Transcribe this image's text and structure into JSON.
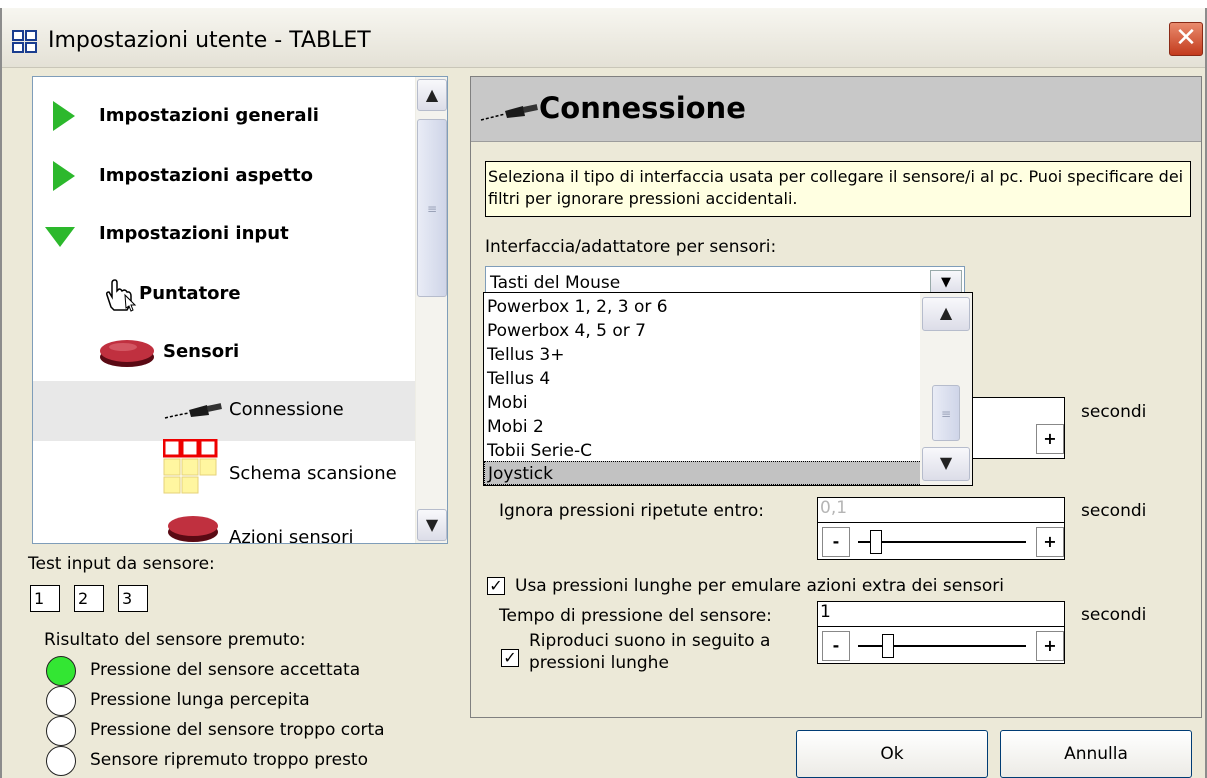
{
  "window": {
    "title": "Impostazioni utente - TABLET",
    "close_label": "✕"
  },
  "tree": {
    "items": [
      {
        "label": "Impostazioni generali"
      },
      {
        "label": "Impostazioni aspetto"
      },
      {
        "label": "Impostazioni input"
      },
      {
        "label": "Puntatore"
      },
      {
        "label": "Sensori"
      },
      {
        "label": "Connessione"
      },
      {
        "label": "Schema scansione"
      },
      {
        "label": "Azioni sensori"
      }
    ]
  },
  "test": {
    "label": "Test input da sensore:",
    "boxes": [
      "1",
      "2",
      "3"
    ],
    "result_label": "Risultato del sensore premuto:",
    "results": [
      "Pressione del sensore accettata",
      "Pressione lunga percepita",
      "Pressione del sensore troppo corta",
      "Sensore ripremuto troppo presto"
    ]
  },
  "panel": {
    "title": "Connessione",
    "info": "Seleziona il tipo di interfaccia usata per collegare il sensore/i al pc. Puoi specificare dei filtri per ignorare pressioni accidentali.",
    "interface_label": "Interfaccia/adattatore per sensori:",
    "interface_value": "Tasti del Mouse",
    "dropdown_options": [
      "Powerbox 1, 2, 3 or 6",
      "Powerbox 4, 5 or 7",
      "Tellus 3+",
      "Tellus 4",
      "Mobi",
      "Mobi 2",
      "Tobii Serie-C",
      "Joystick"
    ],
    "seconds": "secondi",
    "ignore_label": "Ignora pressioni ripetute entro:",
    "ignore_value": "0,1",
    "long_press_label": "Usa pressioni lunghe per emulare azioni extra dei sensori",
    "press_time_label": "Tempo di pressione del sensore:",
    "press_time_value": "1",
    "sound_label_1": "Riproduci suono in seguito a",
    "sound_label_2": "pressioni lunghe",
    "minus": "-",
    "plus": "+"
  },
  "buttons": {
    "ok": "Ok",
    "cancel": "Annulla"
  }
}
